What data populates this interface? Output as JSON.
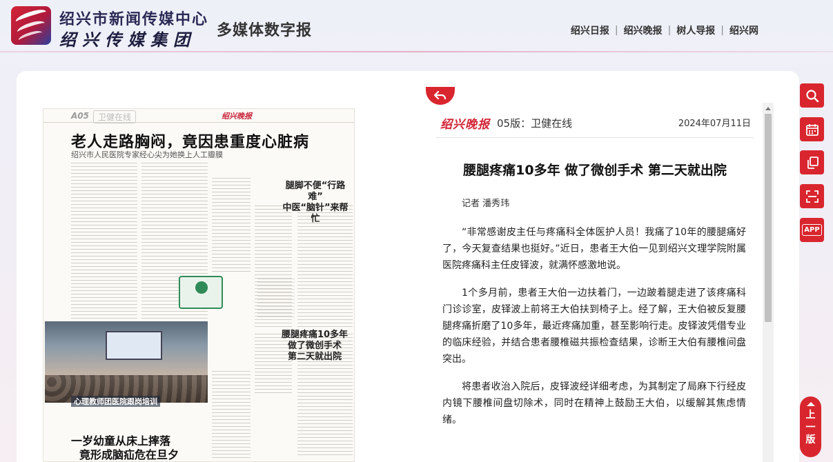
{
  "header": {
    "org_name": "绍兴市新闻传媒中心",
    "group_name": "绍兴传媒集团",
    "product_name": "多媒体数字报",
    "nav": [
      "绍兴日报",
      "绍兴晚报",
      "树人导报",
      "绍兴网"
    ]
  },
  "newspaper_page": {
    "page_number": "A05",
    "section": "卫健在线",
    "masthead": "绍兴晚报",
    "headline_main": "老人走路胸闷，竟因患重度心脏病",
    "subhead_main": "绍兴市人民医院专家经心尖为她换上人工瓣膜",
    "side_title_1": "腿脚不便“行路难”\n中医“脑针”来帮忙",
    "side_title_2": "腰腿疼痛10多年\n做了微创手术\n第二天就出院",
    "photo_caption": "心理教师团医院跟岗培训",
    "headline_bottom_1": "一岁幼童从床上摔落",
    "headline_bottom_2": "竟形成脑疝危在旦夕"
  },
  "article": {
    "brand": "绍兴晚报",
    "edition": "05版：卫健在线",
    "date": "2024年07月11日",
    "title": "腰腿疼痛10多年 做了微创手术 第二天就出院",
    "byline": "记者 潘秀玮",
    "paragraphs": [
      "“非常感谢皮主任与疼痛科全体医护人员！我痛了10年的腰腿痛好了，今天复查结果也挺好。”近日，患者王大伯一见到绍兴文理学院附属医院疼痛科主任皮铎波，就满怀感激地说。",
      "1个多月前，患者王大伯一边扶着门，一边跛着腿走进了该疼痛科门诊诊室，皮铎波上前将王大伯扶到椅子上。经了解，王大伯被反复腰腿疼痛折磨了10多年，最近疼痛加重，甚至影响行走。皮铎波凭借专业的临床经验，并结合患者腰椎磁共振检查结果，诊断王大伯有腰椎间盘突出。",
      "将患者收治入院后，皮铎波经详细考虑，为其制定了局麻下行经皮内镜下腰椎间盘切除术，同时在精神上鼓励王大伯，以缓解其焦虑情绪。"
    ]
  },
  "toolbar": {
    "app_label": "APP",
    "prev_edition_label": "上一版"
  },
  "colors": {
    "accent": "#d9262e",
    "brand_red": "#d32436"
  },
  "icons": [
    "back-icon",
    "search-icon",
    "calendar-icon",
    "copy-icon",
    "scan-icon",
    "scroll-up-arrow-icon"
  ]
}
